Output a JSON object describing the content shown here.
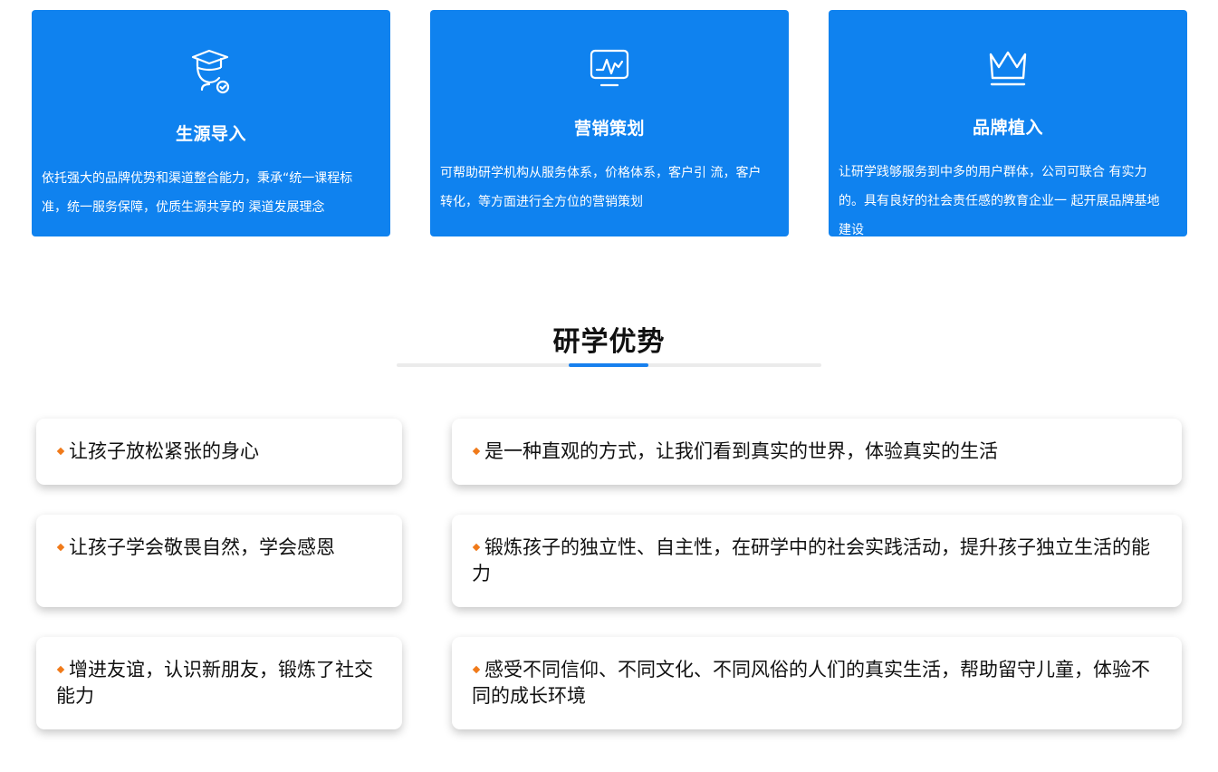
{
  "services": [
    {
      "icon": "graduate-icon",
      "title": "生源导入",
      "description": "依托强大的品牌优势和渠道整合能力，秉承“统一课程标准，统一服务保障，优质生源共享的 渠道发展理念"
    },
    {
      "icon": "chart-monitor-icon",
      "title": "营销策划",
      "description": "可帮助研学机构从服务体系，价格体系，客户引 流，客户转化，等方面进行全方位的营销策划"
    },
    {
      "icon": "crown-icon",
      "title": "品牌植入",
      "description": "让研学践够服务到中多的用户群体，公司可联合 有实力的。具有良好的社会责任感的教育企业一 起开展品牌基地建设"
    }
  ],
  "section": {
    "title": "研学优势"
  },
  "advantages": [
    "让孩子放松紧张的身心",
    "是一种直观的方式，让我们看到真实的世界，体验真实的生活",
    "让孩子学会敬畏自然，学会感恩",
    "锻炼孩子的独立性、自主性，在研学中的社会实践活动，提升孩子独立生活的能力",
    "增进友谊，认识新朋友，锻炼了社交能力",
    "感受不同信仰、不同文化、不同风俗的人们的真实生活，帮助留守儿童，体验不同的成长环境"
  ],
  "colors": {
    "card_blue": "#0f82ef",
    "accent_blue": "#1780ee",
    "bullet_orange": "#f07a1a"
  }
}
